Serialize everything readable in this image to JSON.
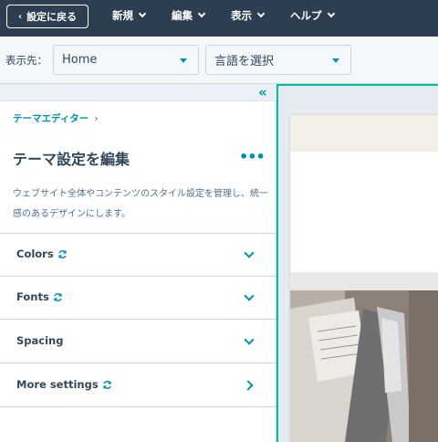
{
  "topbar": {
    "back_label": "設定に戻る",
    "menus": [
      {
        "label": "新規"
      },
      {
        "label": "編集"
      },
      {
        "label": "表示"
      },
      {
        "label": "ヘルプ"
      }
    ]
  },
  "toolbar": {
    "display_label": "表示先：",
    "page_select": {
      "value": "Home"
    },
    "language_select": {
      "value": "言語を選択"
    }
  },
  "panel": {
    "breadcrumb": "テーマエディター",
    "title": "テーマ設定を編集",
    "description": "ウェブサイト全体やコンテンツのスタイル設定を管理し、統一感のあるデザインにします。",
    "sections": [
      {
        "label": "Colors",
        "synced": true,
        "chevron": "down"
      },
      {
        "label": "Fonts",
        "synced": true,
        "chevron": "down"
      },
      {
        "label": "Spacing",
        "synced": false,
        "chevron": "down"
      },
      {
        "label": "More settings",
        "synced": true,
        "chevron": "right"
      }
    ]
  },
  "colors": {
    "topbar": "#2d3e50",
    "accent": "#0091ae",
    "preview_border": "#00bda5"
  }
}
